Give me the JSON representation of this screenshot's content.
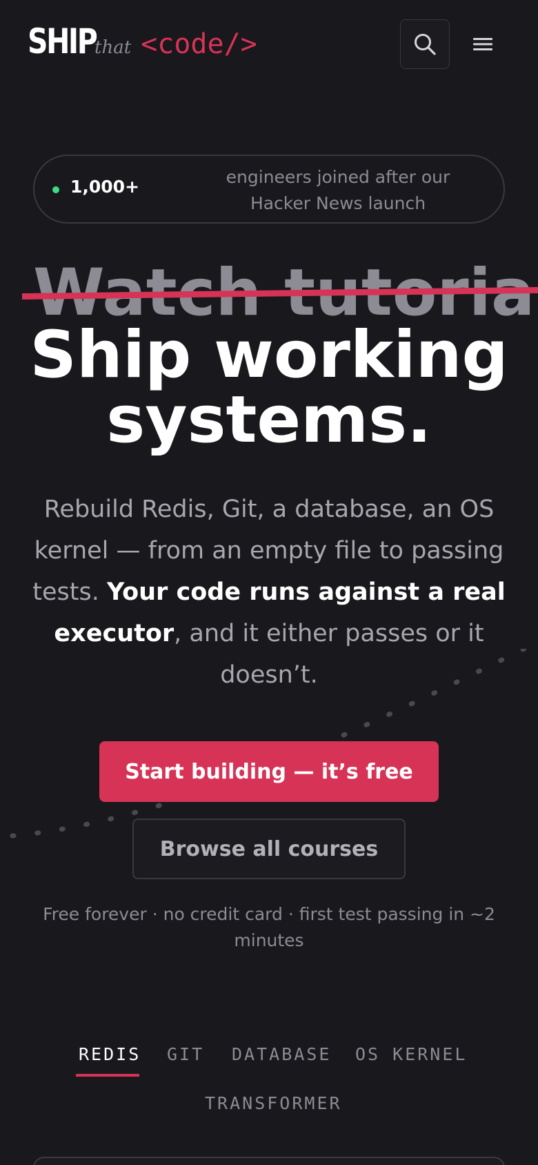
{
  "header": {
    "logo_ship": "SHIP",
    "logo_that": "that",
    "logo_code": "<code/>",
    "search_icon": "search-icon",
    "menu_icon": "hamburger-menu-icon"
  },
  "badge": {
    "count": "1,000+",
    "text": "engineers joined after our Hacker News launch",
    "dot_color": "#3ddc84"
  },
  "hero": {
    "struck_text": "Watch tutorials",
    "headline_line1": "Ship working",
    "headline_line2": "systems.",
    "sub_part1": "Rebuild Redis, Git, a database, an OS kernel — from an empty file to passing tests. ",
    "sub_bold": "Your code runs against a real executor",
    "sub_part2": ", and it either passes or it doesn’t."
  },
  "cta": {
    "primary_label": "Start building — it’s free",
    "secondary_label": "Browse all courses",
    "fineprint": "Free forever · no credit card · first test passing in ~2 minutes"
  },
  "tabs": [
    {
      "label": "REDIS",
      "active": true
    },
    {
      "label": "GIT",
      "active": false
    },
    {
      "label": "DATABASE",
      "active": false
    },
    {
      "label": "OS KERNEL",
      "active": false
    },
    {
      "label": "TRANSFORMER",
      "active": false
    }
  ],
  "colors": {
    "background": "#19181c",
    "accent": "#d63356",
    "muted_text": "#8d8b94",
    "border": "#3a393e"
  }
}
